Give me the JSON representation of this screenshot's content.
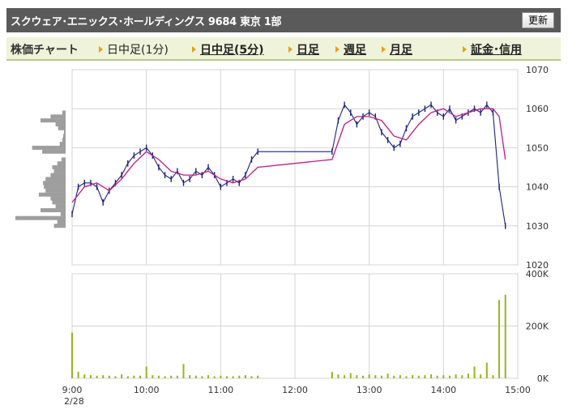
{
  "header": {
    "title": "スクウェア･エニックス･ホールディングス 9684 東京 1部",
    "refresh_label": "更新"
  },
  "tabs": {
    "label": "株価チャート",
    "items": [
      {
        "label": "日中足(1分)",
        "style": "plain"
      },
      {
        "label": "日中足(5分)",
        "style": "link"
      },
      {
        "label": "日足",
        "style": "link"
      },
      {
        "label": "週足",
        "style": "link"
      },
      {
        "label": "月足",
        "style": "link"
      },
      {
        "label": "証金･信用",
        "style": "link"
      }
    ]
  },
  "colors": {
    "price_line": "#1a237e",
    "moving_average": "#c2188a",
    "volume": "#9bb21a",
    "volume_profile": "#9e9e9e",
    "grid": "#d4d4d4"
  },
  "chart_data": [
    {
      "type": "line",
      "title": "",
      "xlabel": "",
      "ylabel": "",
      "x_ticks": [
        "9:00",
        "10:00",
        "11:00",
        "12:00",
        "13:00",
        "14:00",
        "15:00"
      ],
      "date_label": "2/28",
      "y_ticks": [
        "1070",
        "1060",
        "1050",
        "1040",
        "1030",
        "1020"
      ],
      "ylim": [
        1020,
        1070
      ],
      "xlim": [
        "9:00",
        "15:00"
      ],
      "grid": true,
      "series": [
        {
          "role": "price",
          "x": [
            "9:00",
            "9:05",
            "9:10",
            "9:15",
            "9:20",
            "9:25",
            "9:30",
            "9:35",
            "9:40",
            "9:45",
            "9:50",
            "9:55",
            "10:00",
            "10:05",
            "10:10",
            "10:15",
            "10:20",
            "10:25",
            "10:30",
            "10:35",
            "10:40",
            "10:45",
            "10:50",
            "10:55",
            "11:00",
            "11:05",
            "11:10",
            "11:15",
            "11:20",
            "11:25",
            "11:30",
            "12:30",
            "12:35",
            "12:40",
            "12:45",
            "12:50",
            "12:55",
            "13:00",
            "13:05",
            "13:10",
            "13:15",
            "13:20",
            "13:25",
            "13:30",
            "13:35",
            "13:40",
            "13:45",
            "13:50",
            "13:55",
            "14:00",
            "14:05",
            "14:10",
            "14:15",
            "14:20",
            "14:25",
            "14:30",
            "14:35",
            "14:40",
            "14:45",
            "14:50"
          ],
          "values": [
            1033,
            1040,
            1041,
            1041,
            1040,
            1036,
            1039,
            1041,
            1043,
            1046,
            1048,
            1049,
            1050,
            1048,
            1045,
            1043,
            1042,
            1044,
            1041,
            1042,
            1044,
            1043,
            1045,
            1043,
            1040,
            1041,
            1042,
            1041,
            1043,
            1047,
            1049,
            1049,
            1057,
            1061,
            1059,
            1056,
            1058,
            1059,
            1058,
            1054,
            1052,
            1050,
            1051,
            1055,
            1058,
            1059,
            1060,
            1061,
            1059,
            1058,
            1060,
            1057,
            1058,
            1059,
            1060,
            1059,
            1061,
            1059,
            1040,
            1030
          ]
        },
        {
          "role": "moving_average",
          "x": [
            "9:00",
            "9:10",
            "9:20",
            "9:30",
            "9:40",
            "9:50",
            "10:00",
            "10:10",
            "10:20",
            "10:30",
            "10:40",
            "10:50",
            "11:00",
            "11:10",
            "11:20",
            "11:30",
            "12:30",
            "12:40",
            "12:50",
            "13:00",
            "13:10",
            "13:20",
            "13:30",
            "13:40",
            "13:50",
            "14:00",
            "14:10",
            "14:20",
            "14:30",
            "14:40",
            "14:45",
            "14:50"
          ],
          "values": [
            1036,
            1040,
            1041,
            1039,
            1042,
            1046,
            1049,
            1047,
            1044,
            1043,
            1043,
            1044,
            1042,
            1041,
            1042,
            1045,
            1047,
            1056,
            1058,
            1058,
            1057,
            1053,
            1052,
            1056,
            1059,
            1060,
            1058,
            1059,
            1060,
            1060,
            1058,
            1047
          ]
        }
      ]
    },
    {
      "type": "bar",
      "title": "",
      "y_ticks": [
        "400K",
        "200K",
        "0K"
      ],
      "ylim": [
        0,
        400000
      ],
      "x": [
        "9:00",
        "9:05",
        "9:10",
        "9:15",
        "9:20",
        "9:25",
        "9:30",
        "9:35",
        "9:40",
        "9:45",
        "9:50",
        "9:55",
        "10:00",
        "10:05",
        "10:10",
        "10:15",
        "10:20",
        "10:25",
        "10:30",
        "10:35",
        "10:40",
        "10:45",
        "10:50",
        "10:55",
        "11:00",
        "11:05",
        "11:10",
        "11:15",
        "11:20",
        "11:25",
        "11:30",
        "12:30",
        "12:35",
        "12:40",
        "12:45",
        "12:50",
        "12:55",
        "13:00",
        "13:05",
        "13:10",
        "13:15",
        "13:20",
        "13:25",
        "13:30",
        "13:35",
        "13:40",
        "13:45",
        "13:50",
        "13:55",
        "14:00",
        "14:05",
        "14:10",
        "14:15",
        "14:20",
        "14:25",
        "14:30",
        "14:35",
        "14:40",
        "14:45",
        "14:50"
      ],
      "values": [
        175000,
        25000,
        15000,
        12000,
        10000,
        12000,
        10000,
        8000,
        15000,
        8000,
        10000,
        10000,
        45000,
        12000,
        10000,
        8000,
        10000,
        10000,
        55000,
        12000,
        10000,
        8000,
        12000,
        8000,
        10000,
        8000,
        8000,
        10000,
        12000,
        8000,
        10000,
        25000,
        15000,
        12000,
        20000,
        12000,
        10000,
        15000,
        12000,
        10000,
        18000,
        10000,
        12000,
        8000,
        12000,
        10000,
        12000,
        15000,
        10000,
        12000,
        10000,
        15000,
        12000,
        18000,
        45000,
        15000,
        60000,
        12000,
        300000,
        320000
      ]
    },
    {
      "type": "bar",
      "orientation": "horizontal",
      "title": "",
      "price_levels": [
        1060,
        1059,
        1058,
        1057,
        1056,
        1055,
        1054,
        1053,
        1052,
        1051,
        1050,
        1049,
        1048,
        1047,
        1046,
        1045,
        1044,
        1043,
        1042,
        1041,
        1040,
        1039,
        1038,
        1037,
        1036,
        1035,
        1034,
        1033,
        1032,
        1031,
        1030
      ],
      "values": [
        0,
        4,
        18,
        30,
        12,
        9,
        2,
        3,
        4,
        7,
        40,
        28,
        0,
        5,
        10,
        16,
        14,
        18,
        24,
        27,
        26,
        24,
        32,
        18,
        16,
        12,
        30,
        6,
        60,
        10,
        14
      ]
    }
  ]
}
